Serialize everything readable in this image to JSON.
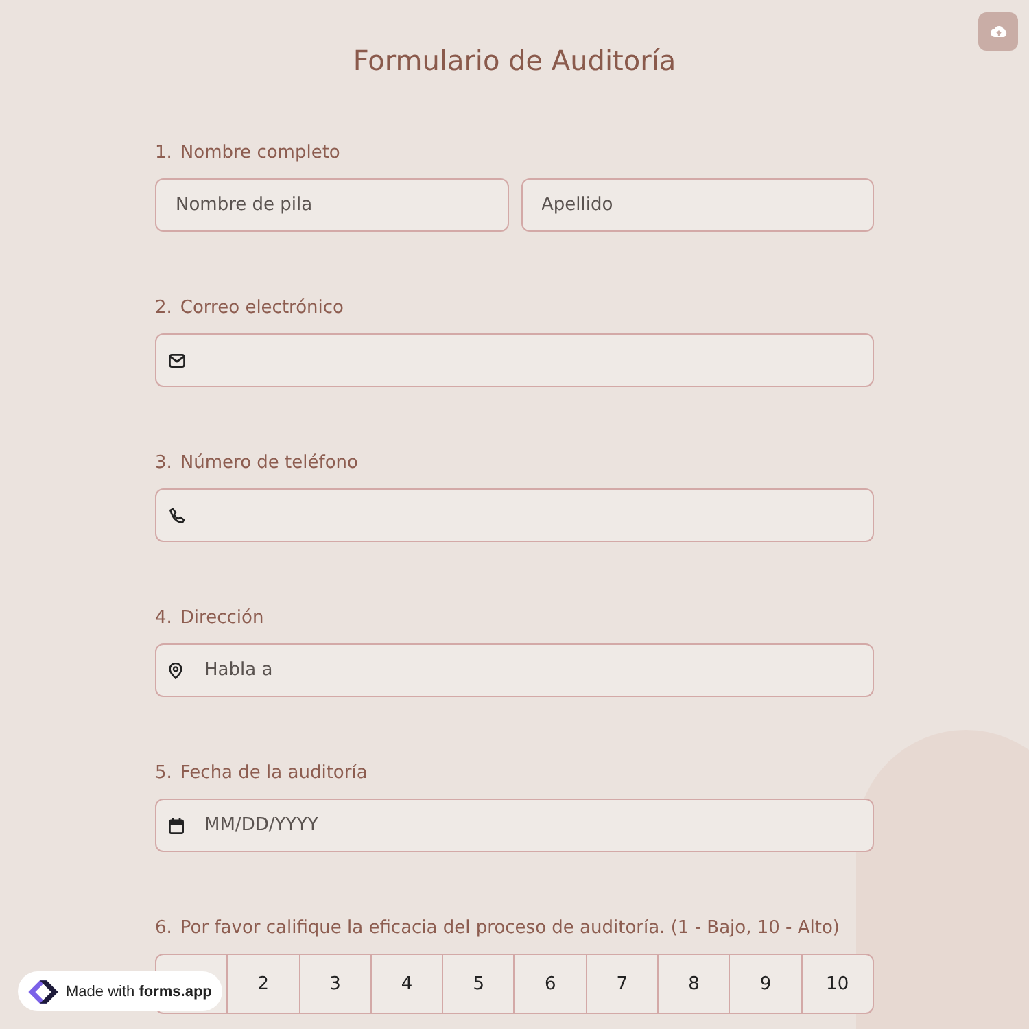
{
  "title": "Formulario de Auditoría",
  "questions": [
    {
      "number": "1.",
      "label": "Nombre completo",
      "kind": "name",
      "placeholders": [
        "Nombre de pila",
        "Apellido"
      ]
    },
    {
      "number": "2.",
      "label": "Correo electrónico",
      "kind": "email"
    },
    {
      "number": "3.",
      "label": "Número de teléfono",
      "kind": "phone"
    },
    {
      "number": "4.",
      "label": "Dirección",
      "kind": "address",
      "placeholder": "Habla a"
    },
    {
      "number": "5.",
      "label": "Fecha de la auditoría",
      "kind": "date",
      "placeholder": "MM/DD/YYYY"
    },
    {
      "number": "6.",
      "label": "Por favor califique la eficacia del proceso de auditoría. (1 - Bajo, 10 - Alto)",
      "kind": "rating",
      "options": [
        "2",
        "3",
        "4",
        "5",
        "6",
        "7",
        "8",
        "9",
        "10"
      ]
    }
  ],
  "badge": {
    "text": "Made with **forms.app**"
  }
}
